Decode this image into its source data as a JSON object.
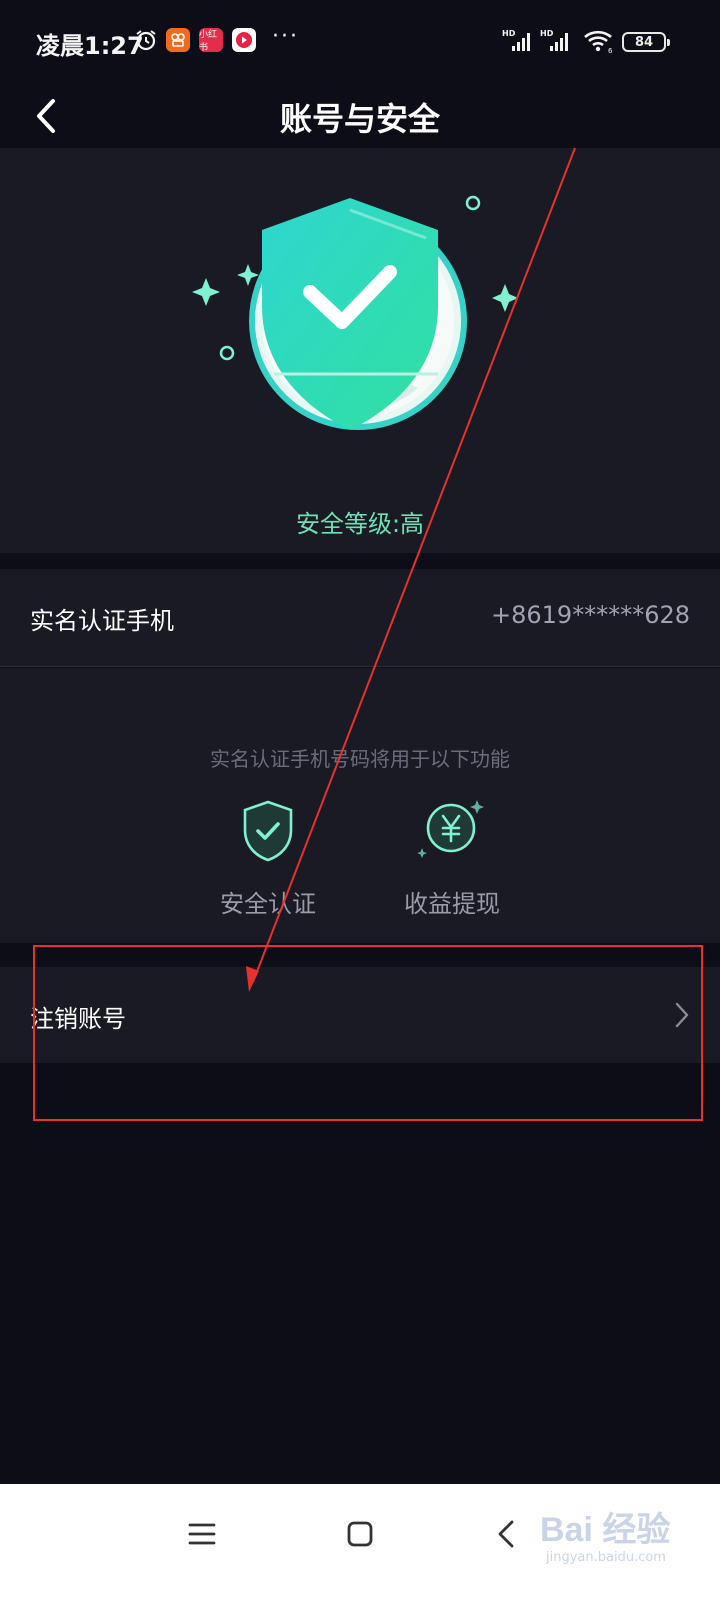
{
  "status_bar": {
    "time": "凌晨1:27",
    "app_xiaohongshu": "小红书",
    "more": "···",
    "battery": "84"
  },
  "header": {
    "title": "账号与安全"
  },
  "security": {
    "level_text": "安全等级:高"
  },
  "phone": {
    "label": "实名认证手机",
    "value": "+8619******628"
  },
  "usage": {
    "hint": "实名认证手机号码将用于以下功能",
    "features": [
      {
        "label": "安全认证",
        "icon": "shield-check-icon"
      },
      {
        "label": "收益提现",
        "icon": "yuan-coin-icon"
      }
    ]
  },
  "deactivate": {
    "label": "注销账号"
  },
  "colors": {
    "accent": "#6fe0b4",
    "annotation": "#e5322e",
    "background": "#0d0d18",
    "card": "#1a1a24"
  },
  "watermark": {
    "brand": "Bai 经验",
    "url": "jingyan.baidu.com"
  }
}
